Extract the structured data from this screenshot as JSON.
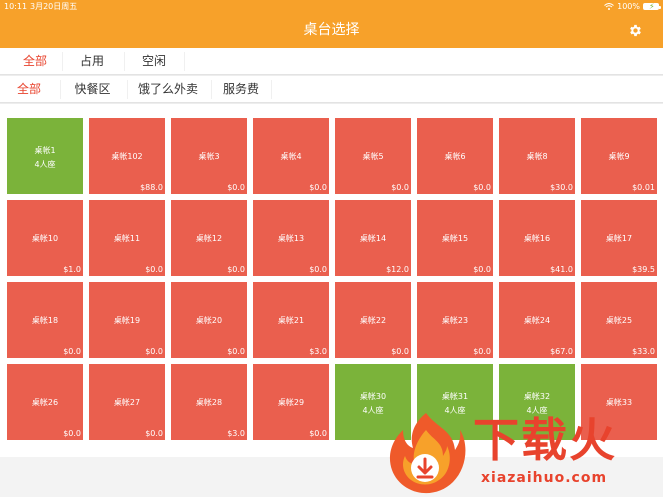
{
  "status_bar": {
    "time": "10:11",
    "date": "3月20日周五",
    "battery": "100%"
  },
  "nav": {
    "title": "桌台选择"
  },
  "status_tabs": [
    {
      "label": "全部",
      "active": true
    },
    {
      "label": "占用",
      "active": false
    },
    {
      "label": "空闲",
      "active": false
    }
  ],
  "area_tabs": [
    {
      "label": "全部",
      "active": true
    },
    {
      "label": "快餐区",
      "active": false
    },
    {
      "label": "饿了么外卖",
      "active": false
    },
    {
      "label": "服务费",
      "active": false
    }
  ],
  "colors": {
    "brand_orange": "#f7a12a",
    "occupied_red": "#ea5f4e",
    "free_green": "#7bb33a",
    "active_tab_red": "#e8432d"
  },
  "tables": [
    {
      "name": "桌帐1",
      "seats": "4人座",
      "amount": "",
      "free": true
    },
    {
      "name": "桌帐102",
      "seats": "",
      "amount": "$88.0",
      "free": false
    },
    {
      "name": "桌帐3",
      "seats": "",
      "amount": "$0.0",
      "free": false
    },
    {
      "name": "桌帐4",
      "seats": "",
      "amount": "$0.0",
      "free": false
    },
    {
      "name": "桌帐5",
      "seats": "",
      "amount": "$0.0",
      "free": false
    },
    {
      "name": "桌帐6",
      "seats": "",
      "amount": "$0.0",
      "free": false
    },
    {
      "name": "桌帐8",
      "seats": "",
      "amount": "$30.0",
      "free": false
    },
    {
      "name": "桌帐9",
      "seats": "",
      "amount": "$0.01",
      "free": false
    },
    {
      "name": "桌帐10",
      "seats": "",
      "amount": "$1.0",
      "free": false
    },
    {
      "name": "桌帐11",
      "seats": "",
      "amount": "$0.0",
      "free": false
    },
    {
      "name": "桌帐12",
      "seats": "",
      "amount": "$0.0",
      "free": false
    },
    {
      "name": "桌帐13",
      "seats": "",
      "amount": "$0.0",
      "free": false
    },
    {
      "name": "桌帐14",
      "seats": "",
      "amount": "$12.0",
      "free": false
    },
    {
      "name": "桌帐15",
      "seats": "",
      "amount": "$0.0",
      "free": false
    },
    {
      "name": "桌帐16",
      "seats": "",
      "amount": "$41.0",
      "free": false
    },
    {
      "name": "桌帐17",
      "seats": "",
      "amount": "$39.5",
      "free": false
    },
    {
      "name": "桌帐18",
      "seats": "",
      "amount": "$0.0",
      "free": false
    },
    {
      "name": "桌帐19",
      "seats": "",
      "amount": "$0.0",
      "free": false
    },
    {
      "name": "桌帐20",
      "seats": "",
      "amount": "$0.0",
      "free": false
    },
    {
      "name": "桌帐21",
      "seats": "",
      "amount": "$3.0",
      "free": false
    },
    {
      "name": "桌帐22",
      "seats": "",
      "amount": "$0.0",
      "free": false
    },
    {
      "name": "桌帐23",
      "seats": "",
      "amount": "$0.0",
      "free": false
    },
    {
      "name": "桌帐24",
      "seats": "",
      "amount": "$67.0",
      "free": false
    },
    {
      "name": "桌帐25",
      "seats": "",
      "amount": "$33.0",
      "free": false
    },
    {
      "name": "桌帐26",
      "seats": "",
      "amount": "$0.0",
      "free": false
    },
    {
      "name": "桌帐27",
      "seats": "",
      "amount": "$0.0",
      "free": false
    },
    {
      "name": "桌帐28",
      "seats": "",
      "amount": "$3.0",
      "free": false
    },
    {
      "name": "桌帐29",
      "seats": "",
      "amount": "$0.0",
      "free": false
    },
    {
      "name": "桌帐30",
      "seats": "4人座",
      "amount": "",
      "free": true
    },
    {
      "name": "桌帐31",
      "seats": "4人座",
      "amount": "",
      "free": true
    },
    {
      "name": "桌帐32",
      "seats": "4人座",
      "amount": "",
      "free": true
    },
    {
      "name": "桌帐33",
      "seats": "",
      "amount": "",
      "free": false
    }
  ],
  "watermark": {
    "brand": "下载火",
    "domain": "xiazaihuo.com"
  }
}
